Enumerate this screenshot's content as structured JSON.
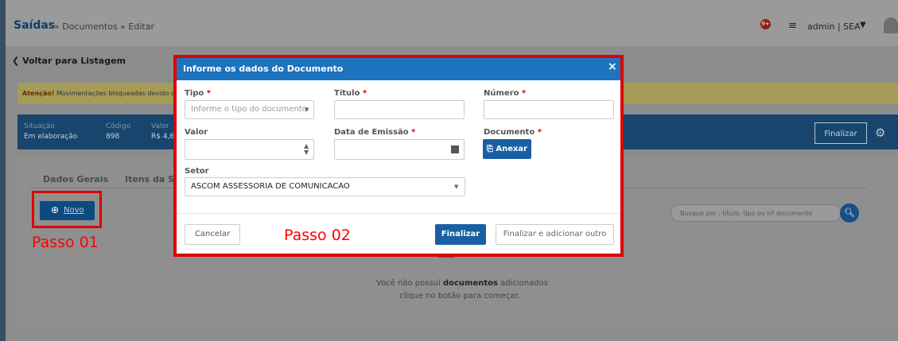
{
  "header": {
    "breadcrumb_main": "Saídas",
    "breadcrumb_rest": "» Documentos » Editar",
    "notification_count": "9+",
    "user_label": "admin | SEA"
  },
  "page": {
    "back_link": "Voltar para Listagem",
    "alert_bold": "Atenção!",
    "alert_text": " Movimentações bloqueadas devido a l",
    "status": {
      "situacao_label": "Situação",
      "situacao_value": "Em elaboração",
      "codigo_label": "Código",
      "codigo_value": "898",
      "valor_label": "Valor",
      "valor_value": "R$ 4,6"
    },
    "finalizar_top": "Finalizar",
    "tabs": [
      "Dados Gerais",
      "Itens da Saí"
    ],
    "novo_label": "Novo",
    "search_placeholder": "Busque por : título, tipo ou nº documento",
    "empty_line1_pre": "Você não possui ",
    "empty_line1_bold": "documentos",
    "empty_line1_post": " adicionados",
    "empty_line2": "clique no botão para começar."
  },
  "annotations": {
    "step1": "Passo 01",
    "step2": "Passo 02"
  },
  "modal": {
    "title": "Informe os dados do Documento",
    "close": "×",
    "fields": {
      "tipo_label": "Tipo",
      "tipo_placeholder": "Informe o tipo do documento",
      "titulo_label": "Título",
      "numero_label": "Número",
      "valor_label": "Valor",
      "data_label": "Data de Emissão",
      "documento_label": "Documento",
      "anexar_label": "Anexar",
      "setor_label": "Setor",
      "setor_value": "ASCOM ASSESSORIA DE COMUNICACAO"
    },
    "required_mark": "*",
    "buttons": {
      "cancel": "Cancelar",
      "finalizar": "Finalizar",
      "finalizar_outro": "Finalizar e adicionar outro"
    }
  },
  "colors": {
    "modal_header": "#1e73be",
    "primary_button": "#1a5fa3",
    "annotation_red": "#e00000"
  }
}
